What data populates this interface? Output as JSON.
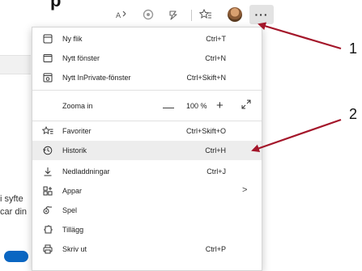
{
  "background_title_fragment": [
    "",
    "p"
  ],
  "toolbar": {
    "icons": [
      "read-aloud-icon",
      "circle-icon",
      "copilot-icon",
      "favorites-icon",
      "profile-avatar",
      "more-icon"
    ],
    "more_label": "···"
  },
  "page_fragments": {
    "line1": "i syfte",
    "line2": "car din"
  },
  "menu": {
    "items": [
      {
        "label": "Ny flik",
        "shortcut": "Ctrl+T",
        "icon": "new-tab-icon"
      },
      {
        "label": "Nytt fönster",
        "shortcut": "Ctrl+N",
        "icon": "new-window-icon"
      },
      {
        "label": "Nytt InPrivate-fönster",
        "shortcut": "Ctrl+Skift+N",
        "icon": "inprivate-icon"
      },
      {
        "label": "Favoriter",
        "shortcut": "Ctrl+Skift+O",
        "icon": "favorites-icon"
      },
      {
        "label": "Historik",
        "shortcut": "Ctrl+H",
        "icon": "history-icon"
      },
      {
        "label": "Nedladdningar",
        "shortcut": "Ctrl+J",
        "icon": "download-icon"
      },
      {
        "label": "Appar",
        "shortcut": "",
        "icon": "apps-icon",
        "submenu": ">"
      },
      {
        "label": "Spel",
        "shortcut": "",
        "icon": "games-icon"
      },
      {
        "label": "Tillägg",
        "shortcut": "",
        "icon": "extensions-icon"
      },
      {
        "label": "Skriv ut",
        "shortcut": "Ctrl+P",
        "icon": "print-icon"
      }
    ],
    "zoom": {
      "label": "Zooma in",
      "value": "100 %",
      "minus": "—",
      "plus": "+"
    },
    "highlighted": "Historik"
  },
  "callouts": [
    "1",
    "2"
  ],
  "colors": {
    "arrow": "#a4162a",
    "menu_highlight": "#ededed",
    "more_button_bg": "#e3e3e3",
    "toggle": "#0a66c2"
  }
}
